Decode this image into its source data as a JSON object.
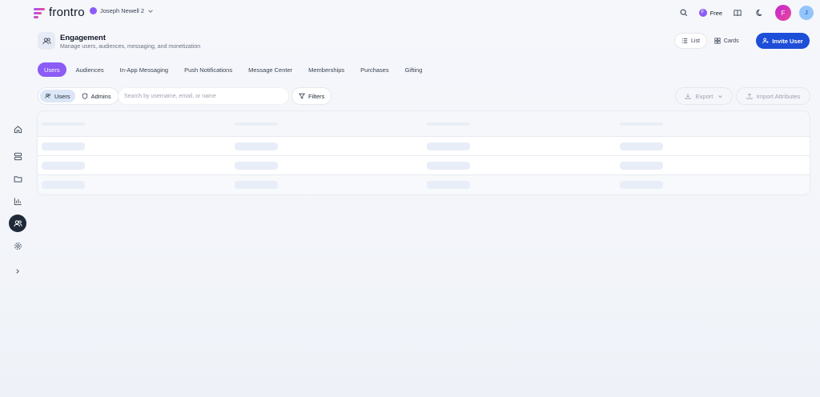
{
  "brand": {
    "name": "frontro"
  },
  "workspace": {
    "name": "Joseph Newell 2"
  },
  "topbar": {
    "plan_label": "Free",
    "plan_badge": "F",
    "brand_avatar": "F",
    "user_avatar_initial": "J"
  },
  "header": {
    "title": "Engagement",
    "subtitle": "Manage users, audiences, messaging, and monetization",
    "view_list_label": "List",
    "view_cards_label": "Cards",
    "invite_label": "Invite User"
  },
  "tabs": [
    {
      "label": "Users",
      "active": true
    },
    {
      "label": "Audiences"
    },
    {
      "label": "In-App Messaging"
    },
    {
      "label": "Push Notifications"
    },
    {
      "label": "Message Center"
    },
    {
      "label": "Memberships"
    },
    {
      "label": "Purchases"
    },
    {
      "label": "Gifting"
    }
  ],
  "filters": {
    "segment_users": "Users",
    "segment_admins": "Admins",
    "search_placeholder": "Search by username, email, or name",
    "filters_label": "Filters",
    "export_label": "Export",
    "import_label": "Import Attributes"
  },
  "sidebar": [
    {
      "icon": "home-icon"
    },
    {
      "icon": "layers-icon"
    },
    {
      "icon": "folder-icon"
    },
    {
      "icon": "bar-chart-icon"
    },
    {
      "icon": "users-icon",
      "active": true
    },
    {
      "icon": "gear-icon"
    },
    {
      "icon": "chevron-right-icon"
    }
  ],
  "colors": {
    "accent": "#8b5cf6",
    "primary": "#1d4ed8",
    "sidebar_active": "#1f2937"
  }
}
